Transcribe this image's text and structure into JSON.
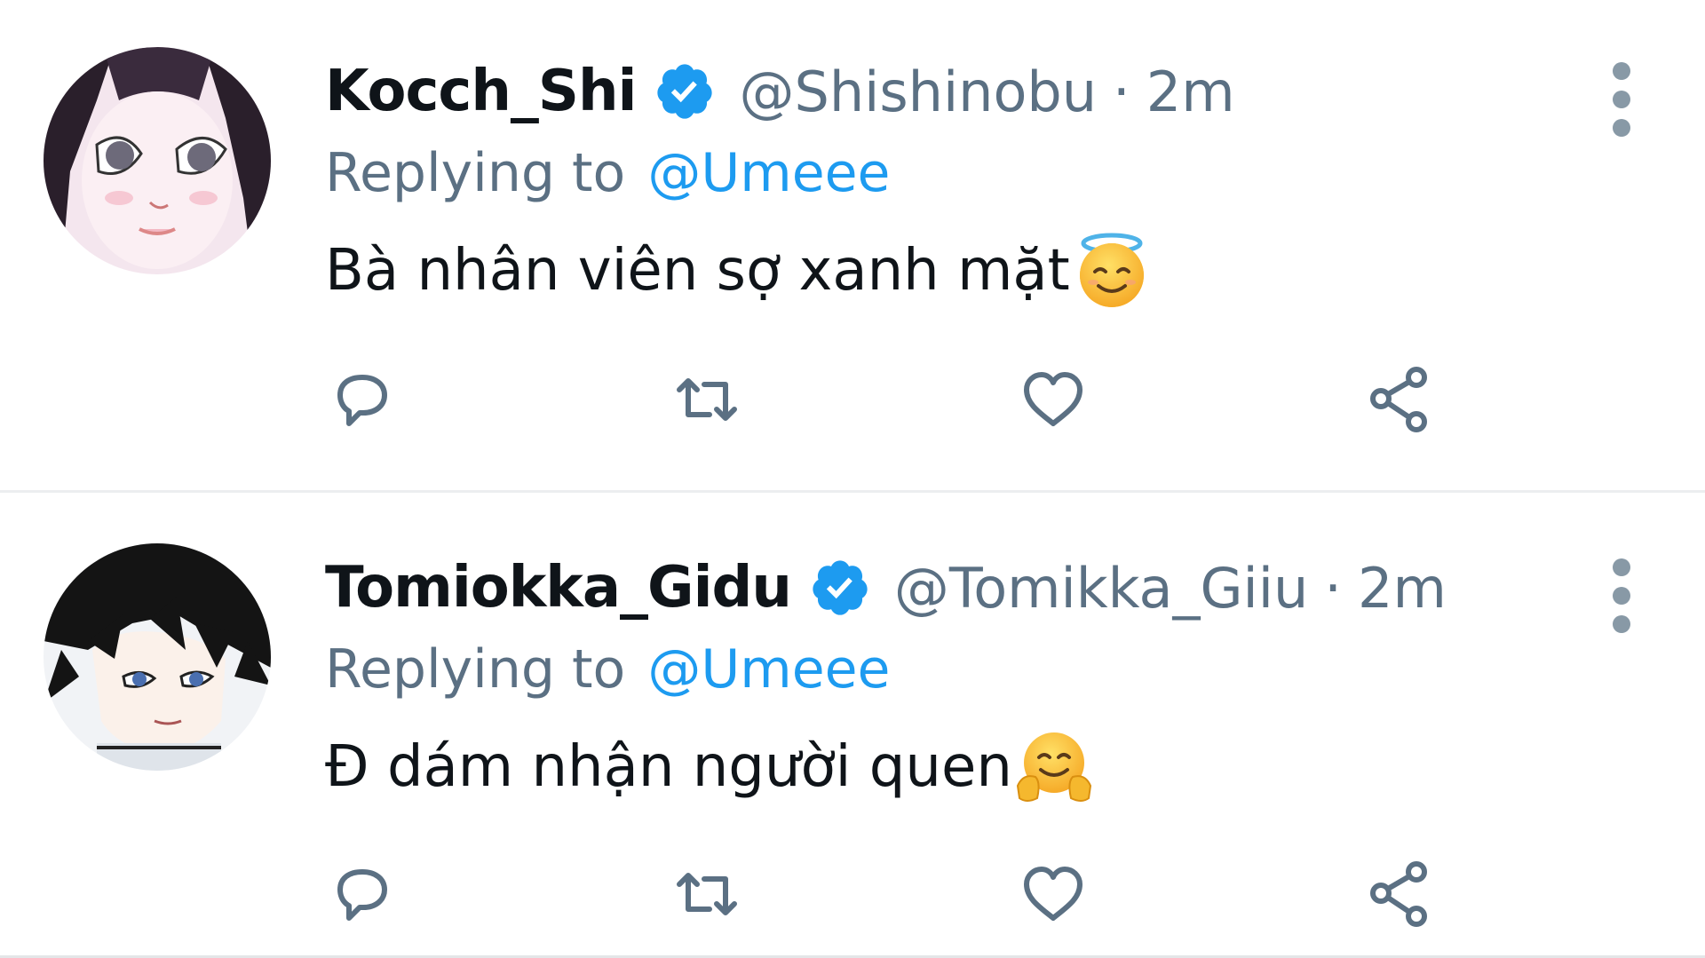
{
  "colors": {
    "text_primary": "#0f1419",
    "text_secondary": "#5b7083",
    "accent": "#1d9bf0",
    "verified": "#1d9bf0",
    "icon": "#5b7083"
  },
  "tweets": [
    {
      "display_name": "Kocch_Shi",
      "verified": true,
      "handle": "@Shishinobu",
      "separator": "·",
      "time": "2m",
      "replying_prefix": "Replying to",
      "replying_to": "@Umeee",
      "text": "Bà nhân viên sợ xanh mặt",
      "emoji": "smiling-face-with-halo",
      "avatar": "anime-avatar-pink-eyes",
      "actions": [
        "reply-icon",
        "retweet-icon",
        "like-icon",
        "share-icon"
      ]
    },
    {
      "display_name": "Tomiokka_Gidu",
      "verified": true,
      "handle": "@Tomikka_Giiu",
      "separator": "·",
      "time": "2m",
      "replying_prefix": "Replying to",
      "replying_to": "@Umeee",
      "text": "Đ dám nhận người quen",
      "emoji": "hugging-face",
      "avatar": "anime-avatar-black-hair",
      "actions": [
        "reply-icon",
        "retweet-icon",
        "like-icon",
        "share-icon"
      ]
    }
  ]
}
